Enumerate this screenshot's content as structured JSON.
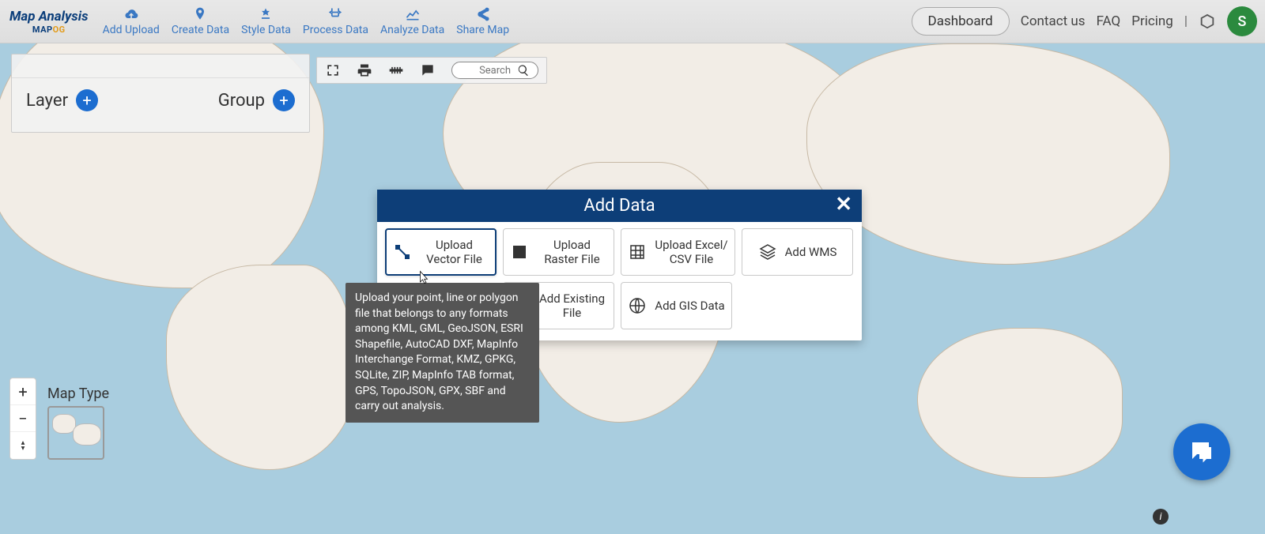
{
  "brand": {
    "title": "Map Analysis",
    "sub_a": "MAP",
    "sub_b": "OG"
  },
  "nav": {
    "add_upload": "Add Upload",
    "create_data": "Create Data",
    "style_data": "Style Data",
    "process_data": "Process Data",
    "analyze_data": "Analyze Data",
    "share_map": "Share Map"
  },
  "header": {
    "dashboard": "Dashboard",
    "contact": "Contact us",
    "faq": "FAQ",
    "pricing": "Pricing",
    "pipe": "|",
    "avatar_initial": "S"
  },
  "side": {
    "layer": "Layer",
    "group": "Group"
  },
  "toolbar": {
    "search_placeholder": "Search"
  },
  "maptype": {
    "label": "Map Type"
  },
  "modal": {
    "title": "Add Data",
    "cards": {
      "vector": "Upload Vector File",
      "raster": "Upload Raster File",
      "excel": "Upload Excel/ CSV File",
      "wms": "Add WMS",
      "existing": "Add Existing File",
      "gis": "Add GIS Data"
    }
  },
  "tooltip": "Upload your point, line or polygon file that belongs to any formats among KML, GML, GeoJSON, ESRI Shapefile, AutoCAD DXF, MapInfo Interchange Format, KMZ, GPKG, SQLite, ZIP, MapInfo TAB format, GPS, TopoJSON, GPX, SBF and carry out analysis.",
  "zoom": {
    "plus": "+",
    "minus": "−"
  },
  "info": "i"
}
